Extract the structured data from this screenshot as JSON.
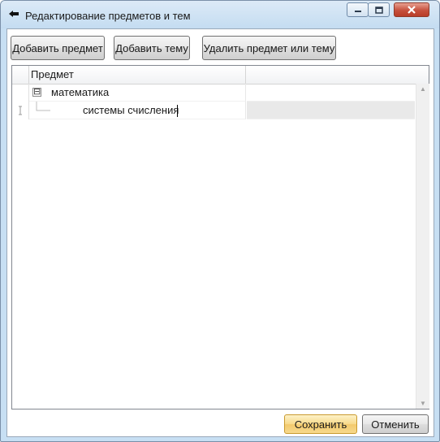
{
  "window": {
    "title": "Редактирование предметов и тем",
    "controls": {
      "minimize": "minimize-icon",
      "maximize": "maximize-icon",
      "close": "close-icon"
    }
  },
  "toolbar": {
    "add_subject_label": "Добавить предмет",
    "add_topic_label": "Добавить тему",
    "delete_label": "Удалить предмет или тему"
  },
  "grid": {
    "columns": [
      "Предмет",
      ""
    ],
    "rows": [
      {
        "text": "математика",
        "expanded": true,
        "expander": "⊟",
        "level": 0
      },
      {
        "text": "системы счисления",
        "level": 1,
        "editing": true
      }
    ]
  },
  "footer": {
    "save_label": "Сохранить",
    "cancel_label": "Отменить"
  },
  "colors": {
    "accent": "#f8d98a",
    "selection": "#e9e9e9"
  }
}
